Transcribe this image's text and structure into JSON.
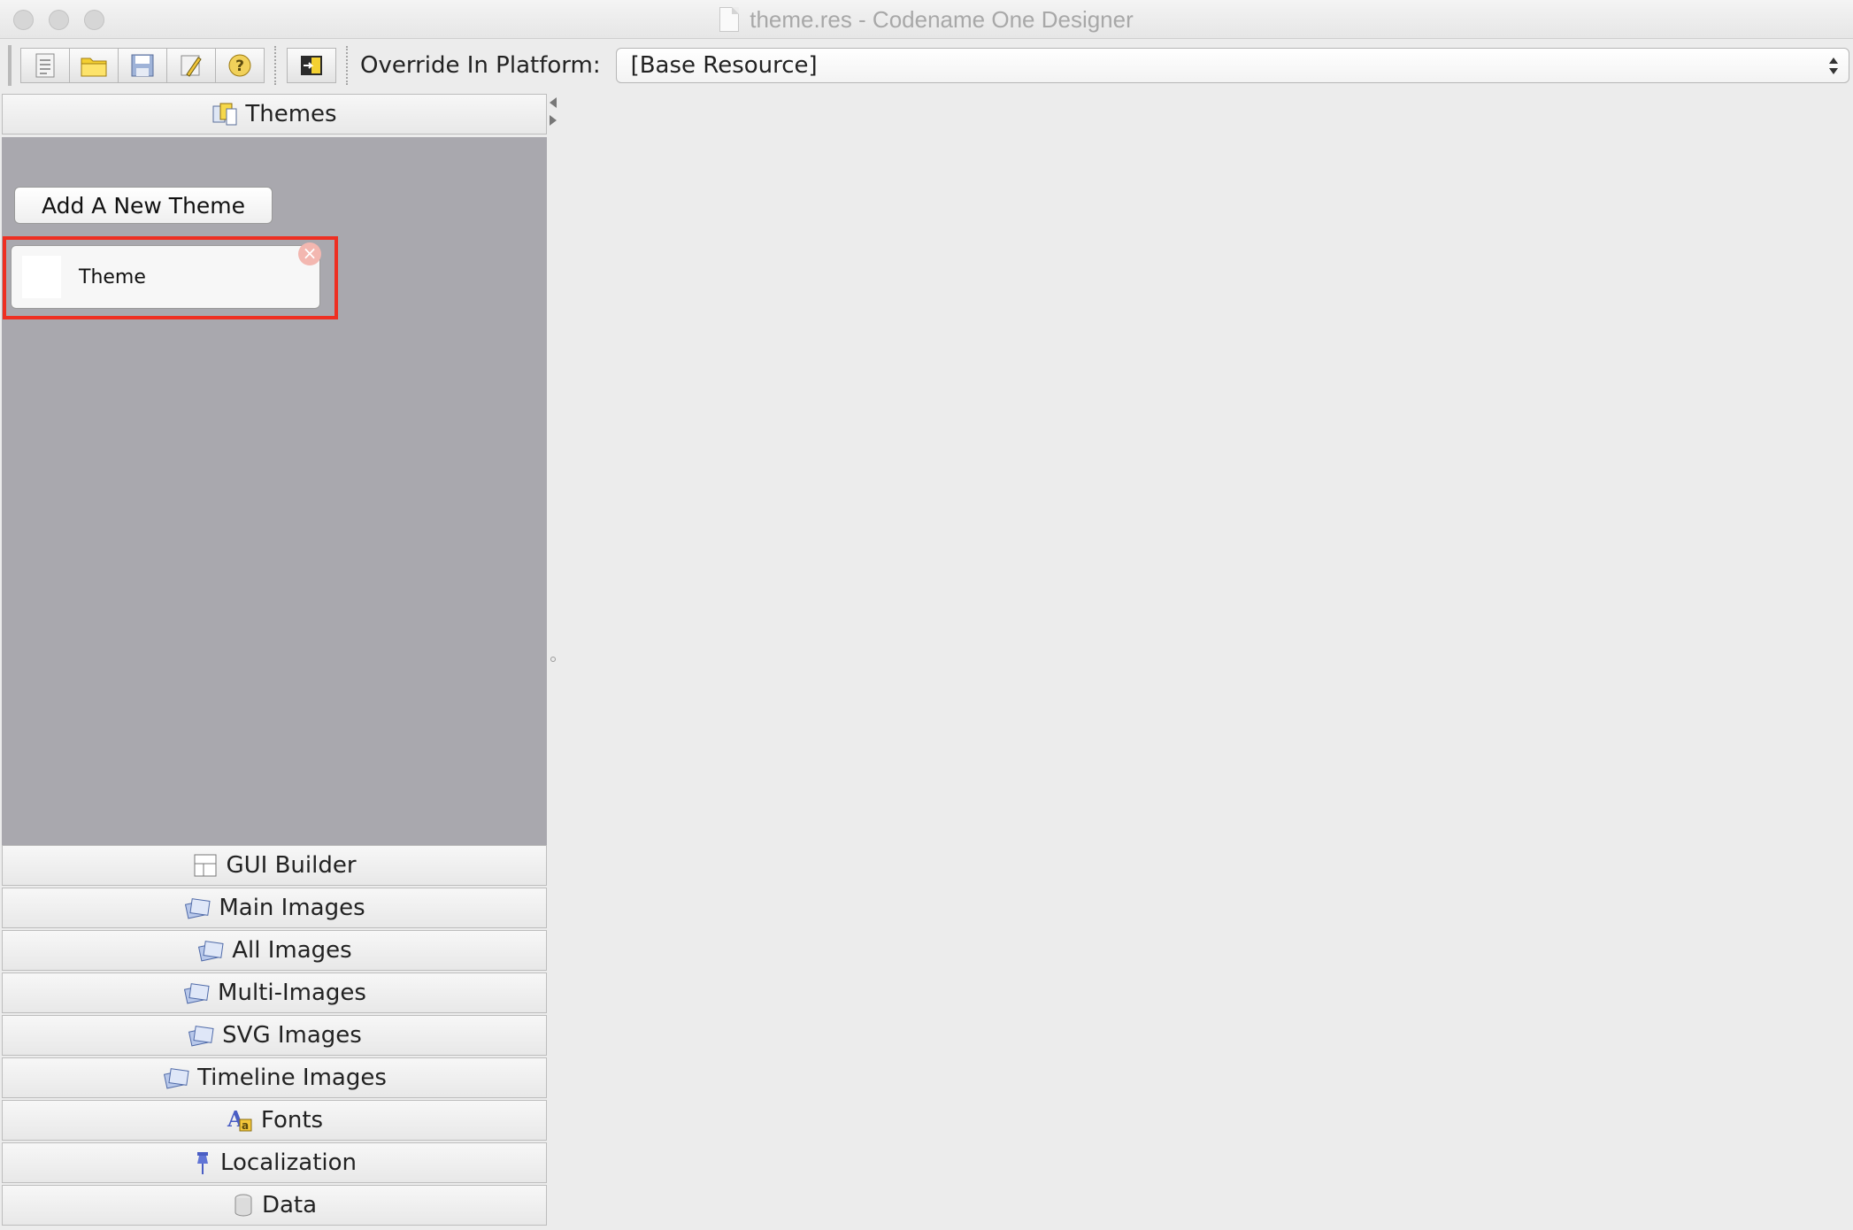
{
  "window": {
    "title": "theme.res - Codename One Designer",
    "icon": "document-icon"
  },
  "toolbar": {
    "buttons": [
      {
        "name": "new-button",
        "icon": "new-document-icon"
      },
      {
        "name": "open-button",
        "icon": "folder-icon"
      },
      {
        "name": "save-button",
        "icon": "save-icon"
      },
      {
        "name": "edit-button",
        "icon": "edit-icon"
      },
      {
        "name": "help-button",
        "icon": "help-icon"
      },
      {
        "name": "import-button",
        "icon": "import-icon"
      }
    ],
    "override_label": "Override In Platform:",
    "override_value": "[Base Resource]"
  },
  "sidebar": {
    "themes": {
      "header": "Themes",
      "icon": "themes-icon",
      "add_button": "Add A New Theme",
      "items": [
        {
          "label": "Theme",
          "selected": true
        }
      ]
    },
    "sections": [
      {
        "label": "GUI Builder",
        "icon": "gui-builder-icon"
      },
      {
        "label": "Main Images",
        "icon": "images-icon"
      },
      {
        "label": "All Images",
        "icon": "images-icon"
      },
      {
        "label": "Multi-Images",
        "icon": "images-icon"
      },
      {
        "label": "SVG Images",
        "icon": "images-icon"
      },
      {
        "label": "Timeline Images",
        "icon": "images-icon"
      },
      {
        "label": "Fonts",
        "icon": "fonts-icon"
      },
      {
        "label": "Localization",
        "icon": "pin-icon"
      },
      {
        "label": "Data",
        "icon": "data-icon"
      }
    ]
  },
  "colors": {
    "highlight_outline": "#ee2f22",
    "themes_panel_bg": "#a9a8ae",
    "window_bg": "#ececec"
  }
}
